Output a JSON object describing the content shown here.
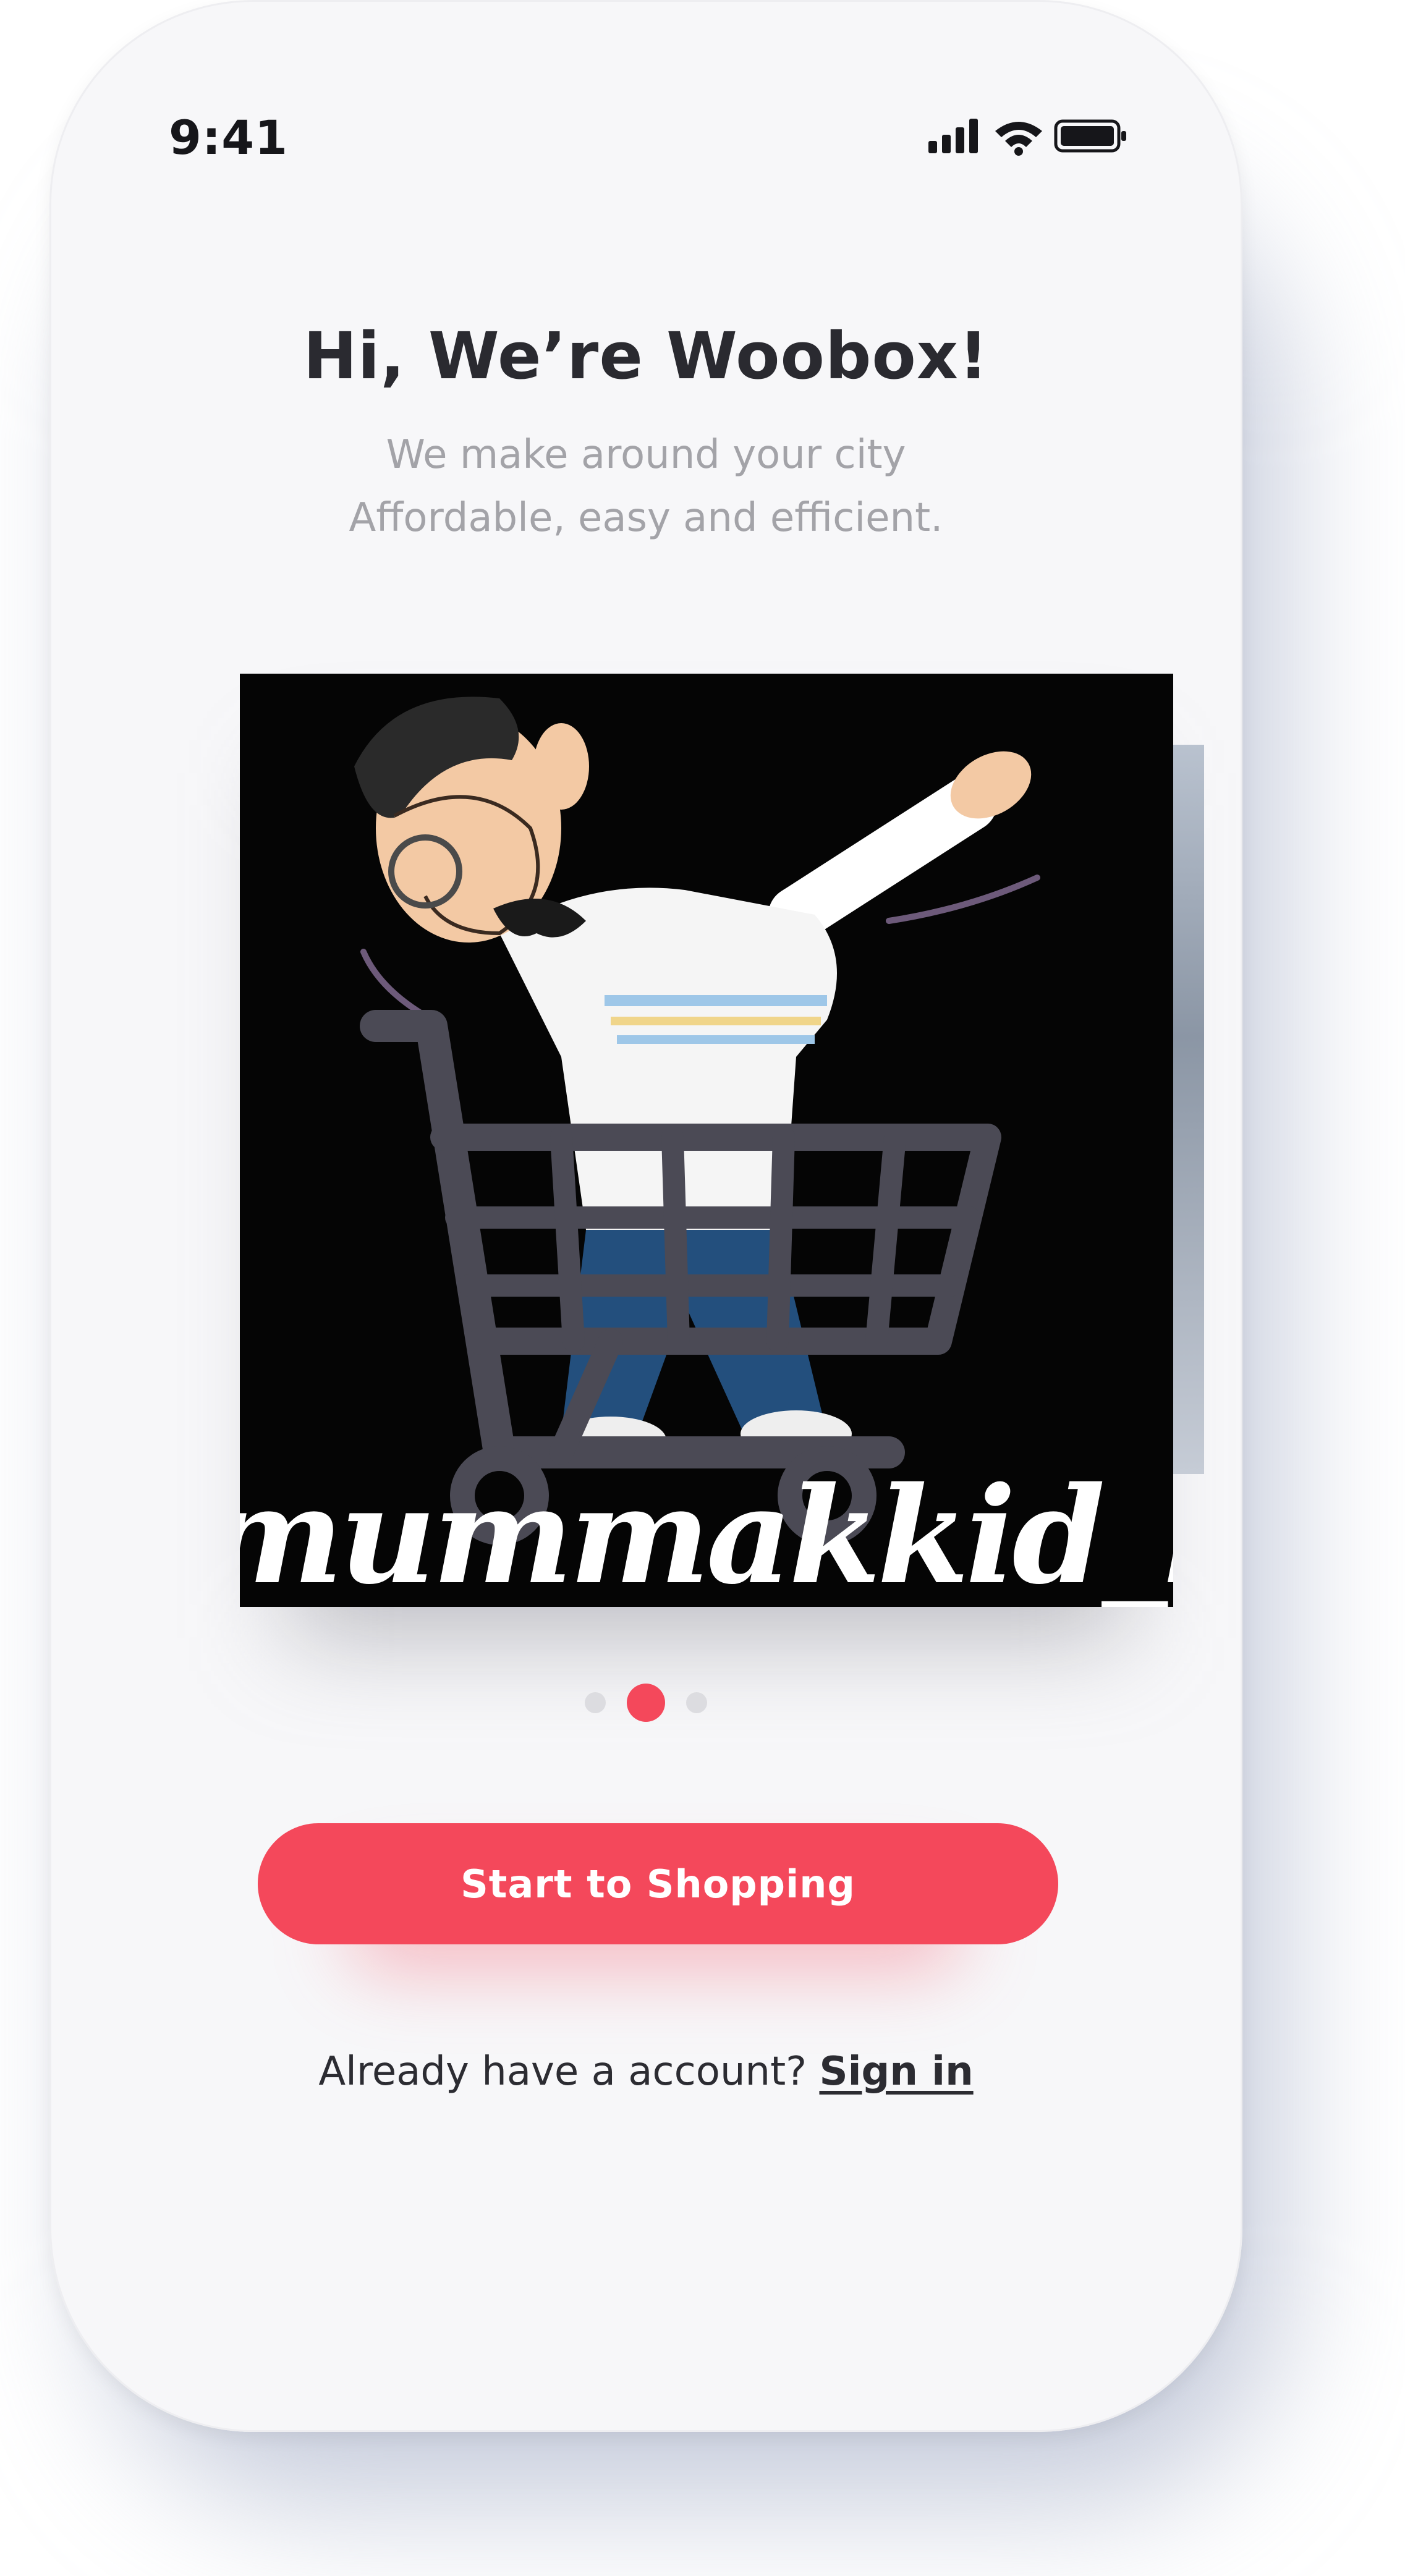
{
  "status_bar": {
    "time": "9:41",
    "icons": [
      "cellular-signal-icon",
      "wifi-icon",
      "battery-icon"
    ]
  },
  "header": {
    "title": "Hi, We’re Woobox!",
    "subtitle": "We make around your city Affordable, easy and efficient."
  },
  "carousel": {
    "image_caption": "mummakkid_ban",
    "page_count": 3,
    "active_index": 1
  },
  "primary_button": {
    "label": "Start to Shopping"
  },
  "footer": {
    "prompt": "Already have a account?",
    "link_label": "Sign in"
  },
  "colors": {
    "accent": "#f4485b",
    "background": "#f7f7f9",
    "title": "#2a2a30",
    "subtitle": "#a3a3a8",
    "dot_inactive": "#dcdce0"
  }
}
